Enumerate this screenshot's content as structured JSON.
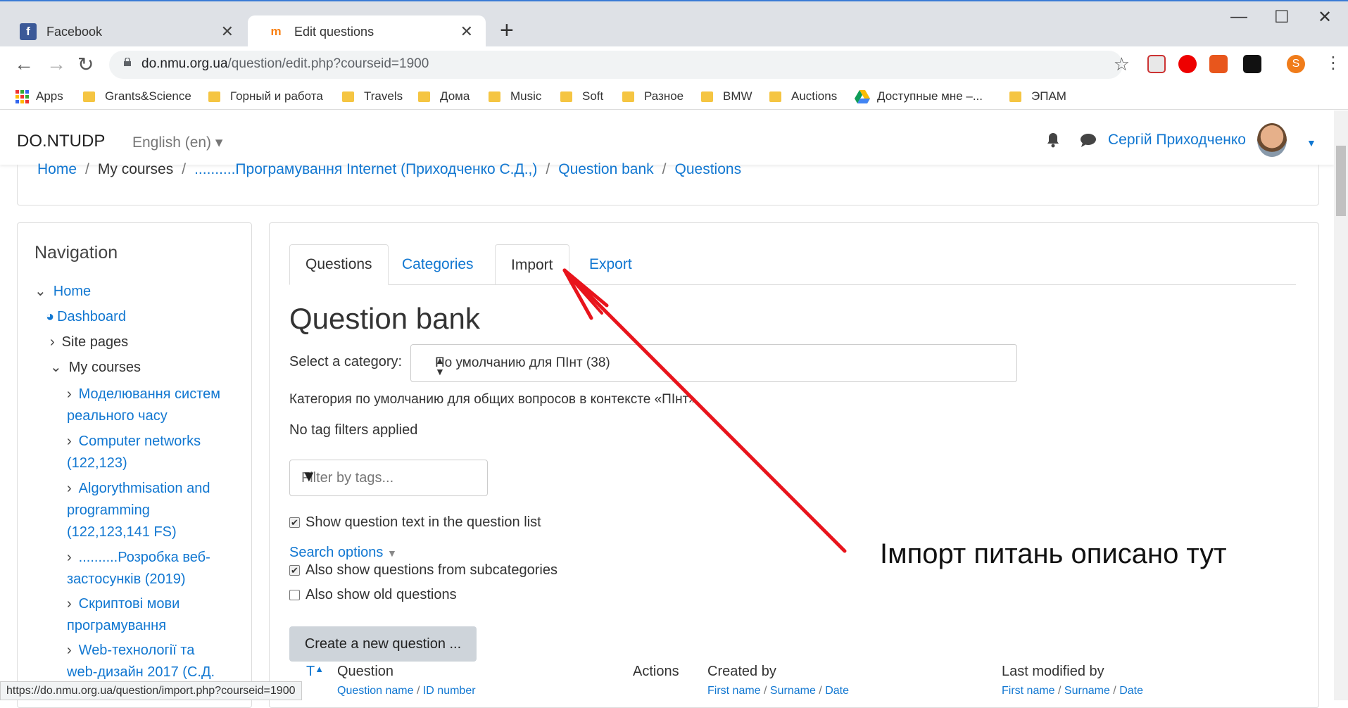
{
  "browser": {
    "tabs": [
      {
        "title": "Facebook",
        "icon": "facebook-icon"
      },
      {
        "title": "Edit questions",
        "icon": "moodle-icon"
      }
    ],
    "new_tab": "+",
    "window_controls": {
      "minimize": "—",
      "maximize": "☐",
      "close": "✕"
    },
    "url_host": "do.nmu.org.ua",
    "url_path": "/question/edit.php?courseid=1900",
    "profile_initial": "S",
    "bookmarks": [
      "Apps",
      "Grants&Science",
      "Горный и работа",
      "Travels",
      "Дома",
      "Music",
      "Soft",
      "Разное",
      "BMW",
      "Auctions",
      "Доступные мне –...",
      "ЭПАМ"
    ],
    "status_url": "https://do.nmu.org.ua/question/import.php?courseid=1900"
  },
  "site": {
    "brand": "DO.NTUDP",
    "language": "English (en) ▾",
    "user_name": "Сергій Приходченко"
  },
  "breadcrumb": [
    "Home",
    "My courses",
    "..........Програмування Internet (Приходченко С.Д.,)",
    "Question bank",
    "Questions"
  ],
  "navigation": {
    "title": "Navigation",
    "home": "Home",
    "dashboard": "Dashboard",
    "site_pages": "Site pages",
    "my_courses": "My courses",
    "courses": [
      [
        "Моделювання систем",
        "реального часу"
      ],
      [
        "Computer networks",
        "(122,123)"
      ],
      [
        "Algorythmisation and",
        "programming",
        "(122,123,141 FS)"
      ],
      [
        "..........Розробка веб-",
        "застосунків (2019)"
      ],
      [
        "Скриптові мови",
        "програмування"
      ],
      [
        "Web-технології та",
        "web-дизайн 2017 (С.Д."
      ]
    ]
  },
  "main": {
    "tabs": [
      "Questions",
      "Categories",
      "Import",
      "Export"
    ],
    "title": "Question bank",
    "category_label": "Select a category:",
    "category_value": "По умолчанию для ПІнт (38)",
    "category_description": "Категория по умолчанию для общих вопросов в контексте «ПІнт».",
    "tag_note": "No tag filters applied",
    "tag_filter_placeholder": "Filter by tags...",
    "show_text_label": "Show question text in the question list",
    "search_options": "Search options",
    "subcategories_label": "Also show questions from subcategories",
    "old_questions_label": "Also show old questions",
    "create_button": "Create a new question ...",
    "columns": {
      "type": "T",
      "question": "Question",
      "actions": "Actions",
      "created_by": "Created by",
      "last_modified": "Last modified by"
    },
    "subheaders": {
      "question_name": "Question name",
      "id_number": "ID number",
      "first_name": "First name",
      "surname": "Surname",
      "date": "Date"
    }
  },
  "annotation": {
    "text": "Імпорт питань описано тут",
    "color": "#e8141c"
  }
}
